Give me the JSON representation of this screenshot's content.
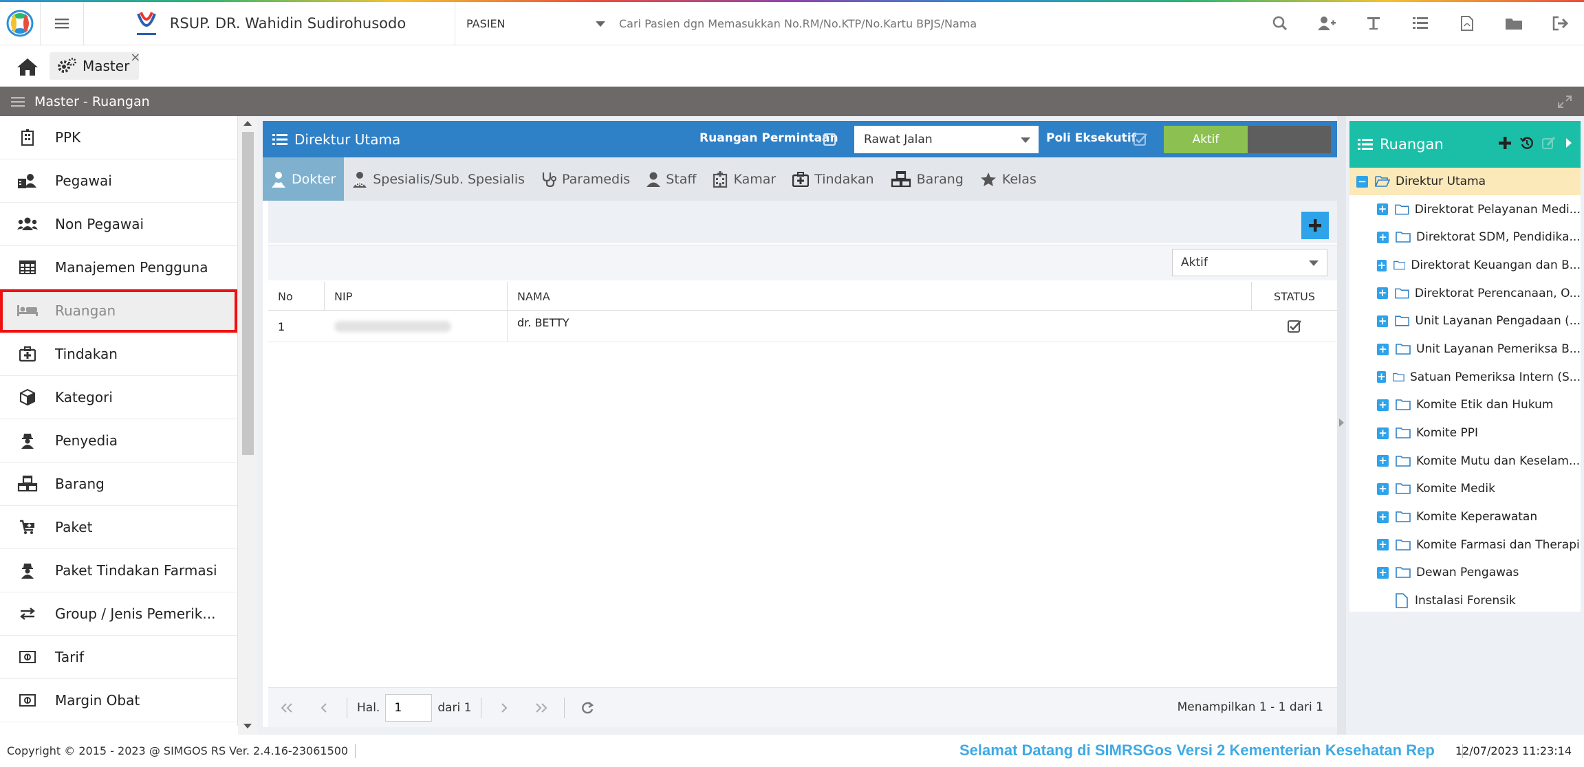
{
  "header": {
    "hospital_name": "RSUP. DR. Wahidin Sudirohusodo",
    "patient_type": "PASIEN",
    "search_placeholder": "Cari Pasien dgn Memasukkan No.RM/No.KTP/No.Kartu BPJS/Nama",
    "icons": [
      "search-icon",
      "add-user-icon",
      "text-icon",
      "list-icon",
      "pdf-icon",
      "folder-icon",
      "logout-icon"
    ]
  },
  "tabs": {
    "master_label": "Master",
    "close_label": "×"
  },
  "section": {
    "title": "Master - Ruangan"
  },
  "sidebar": {
    "items": [
      {
        "label": "PPK",
        "icon": "building-icon"
      },
      {
        "label": "Pegawai",
        "icon": "staff-id-icon"
      },
      {
        "label": "Non Pegawai",
        "icon": "users-icon"
      },
      {
        "label": "Manajemen Pengguna",
        "icon": "table-icon"
      },
      {
        "label": "Ruangan",
        "icon": "bed-icon"
      },
      {
        "label": "Tindakan",
        "icon": "medkit-icon"
      },
      {
        "label": "Kategori",
        "icon": "cube-icon"
      },
      {
        "label": "Penyedia",
        "icon": "user-secret-icon"
      },
      {
        "label": "Barang",
        "icon": "cubes-icon"
      },
      {
        "label": "Paket",
        "icon": "cart-plus-icon"
      },
      {
        "label": "Paket Tindakan Farmasi",
        "icon": "user-secret-icon"
      },
      {
        "label": "Group / Jenis Pemerik...",
        "icon": "exchange-icon"
      },
      {
        "label": "Tarif",
        "icon": "money-icon"
      },
      {
        "label": "Margin Obat",
        "icon": "money-icon"
      }
    ],
    "active_index": 4
  },
  "main": {
    "title": "Direktur Utama",
    "request_room_label": "Ruangan Permintaan",
    "care_type": "Rawat Jalan",
    "poli_label": "Poli Eksekutif",
    "active_toggle_label": "Aktif",
    "subtabs": [
      {
        "label": "Dokter",
        "icon": "user-md-icon"
      },
      {
        "label": "Spesialis/Sub. Spesialis",
        "icon": "user-md-icon"
      },
      {
        "label": "Paramedis",
        "icon": "stethoscope-icon"
      },
      {
        "label": "Staff",
        "icon": "user-icon"
      },
      {
        "label": "Kamar",
        "icon": "hospital-icon"
      },
      {
        "label": "Tindakan",
        "icon": "medkit-icon"
      },
      {
        "label": "Barang",
        "icon": "cubes-icon"
      },
      {
        "label": "Kelas",
        "icon": "star-icon"
      }
    ],
    "status_filter": "Aktif",
    "grid": {
      "columns": [
        "No",
        "NIP",
        "NAMA",
        "STATUS"
      ],
      "rows": [
        {
          "no": "1",
          "nip": "",
          "nama": "dr. BETTY",
          "status_checked": true
        }
      ]
    },
    "pager": {
      "page_label": "Hal.",
      "page_value": "1",
      "of_label": "dari 1",
      "info": "Menampilkan 1 - 1 dari 1"
    }
  },
  "tree": {
    "title": "Ruangan",
    "root": "Direktur Utama",
    "nodes": [
      {
        "label": "Direktorat Pelayanan Medi...",
        "expandable": true
      },
      {
        "label": "Direktorat SDM, Pendidika...",
        "expandable": true
      },
      {
        "label": "Direktorat Keuangan dan B...",
        "expandable": true
      },
      {
        "label": "Direktorat Perencanaan, O...",
        "expandable": true
      },
      {
        "label": "Unit Layanan Pengadaan (...",
        "expandable": true
      },
      {
        "label": "Unit Layanan Pemeriksa B...",
        "expandable": true
      },
      {
        "label": "Satuan Pemeriksa Intern (S...",
        "expandable": true
      },
      {
        "label": "Komite Etik dan Hukum",
        "expandable": true
      },
      {
        "label": "Komite PPI",
        "expandable": true
      },
      {
        "label": "Komite Mutu dan Keselam...",
        "expandable": true
      },
      {
        "label": "Komite Medik",
        "expandable": true
      },
      {
        "label": "Komite Keperawatan",
        "expandable": true
      },
      {
        "label": "Komite Farmasi dan Therapi",
        "expandable": true
      },
      {
        "label": "Dewan Pengawas",
        "expandable": true
      },
      {
        "label": "Instalasi Forensik",
        "expandable": false
      }
    ]
  },
  "footer": {
    "copyright": "Copyright © 2015 - 2023 @ SIMGOS RS Ver. 2.4.16-23061500",
    "marquee": "Selamat Datang di SIMRSGos Versi 2 Kementerian Kesehatan Rep",
    "datetime": "12/07/2023 11:23:14"
  },
  "colors": {
    "header_blue": "#2e80c7",
    "tree_teal": "#1bbfa8",
    "active_green": "#8cc152",
    "section_gray": "#6d6968",
    "highlight_red": "#e11111"
  }
}
